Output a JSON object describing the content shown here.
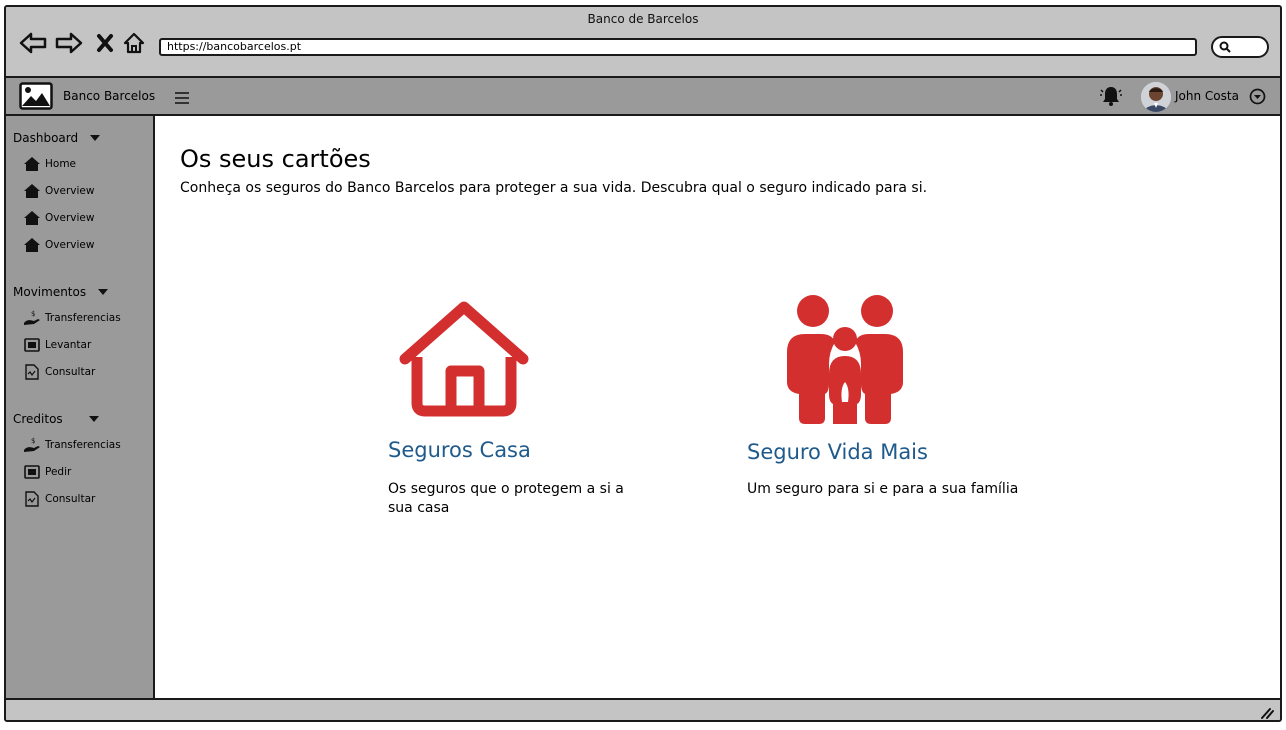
{
  "window": {
    "title": "Banco de Barcelos"
  },
  "browser": {
    "url": "https://bancobarcelos.pt",
    "icons": [
      "back-arrow-icon",
      "forward-arrow-icon",
      "close-icon",
      "home-icon",
      "search-icon"
    ]
  },
  "header": {
    "brand": "Banco Barcelos",
    "user_name": "John Costa",
    "icons": [
      "image-logo-icon",
      "hamburger-menu-icon",
      "notification-bell-icon",
      "chevron-down-circle-icon"
    ]
  },
  "sidebar": {
    "sections": [
      {
        "label": "Dashboard",
        "items": [
          {
            "label": "Home",
            "icon": "home-icon"
          },
          {
            "label": "Overview",
            "icon": "home-icon"
          },
          {
            "label": "Overview",
            "icon": "home-icon"
          },
          {
            "label": "Overview",
            "icon": "home-icon"
          }
        ]
      },
      {
        "label": "Movimentos",
        "items": [
          {
            "label": "Transferencias",
            "icon": "money-hand-icon"
          },
          {
            "label": "Levantar",
            "icon": "cash-register-icon"
          },
          {
            "label": "Consultar",
            "icon": "document-chart-icon"
          }
        ]
      },
      {
        "label": "Creditos",
        "items": [
          {
            "label": "Transferencias",
            "icon": "money-hand-icon"
          },
          {
            "label": "Pedir",
            "icon": "cash-register-icon"
          },
          {
            "label": "Consultar",
            "icon": "document-chart-icon"
          }
        ]
      }
    ]
  },
  "main": {
    "title": "Os seus cartões",
    "subtitle": "Conheça os seguros do Banco Barcelos para proteger a sua vida. Descubra qual o seguro indicado para si.",
    "cards": [
      {
        "title": "Seguros Casa",
        "description": "Os seguros que o protegem a si a sua casa",
        "icon": "house-icon"
      },
      {
        "title": "Seguro Vida Mais",
        "description": "Um seguro para si e para a sua família",
        "icon": "family-icon"
      }
    ]
  },
  "colors": {
    "accent_red": "#d32f2f",
    "link_blue": "#1f5a8c",
    "sidebar_gray": "#9a9a9a",
    "chrome_gray": "#c4c4c4"
  }
}
